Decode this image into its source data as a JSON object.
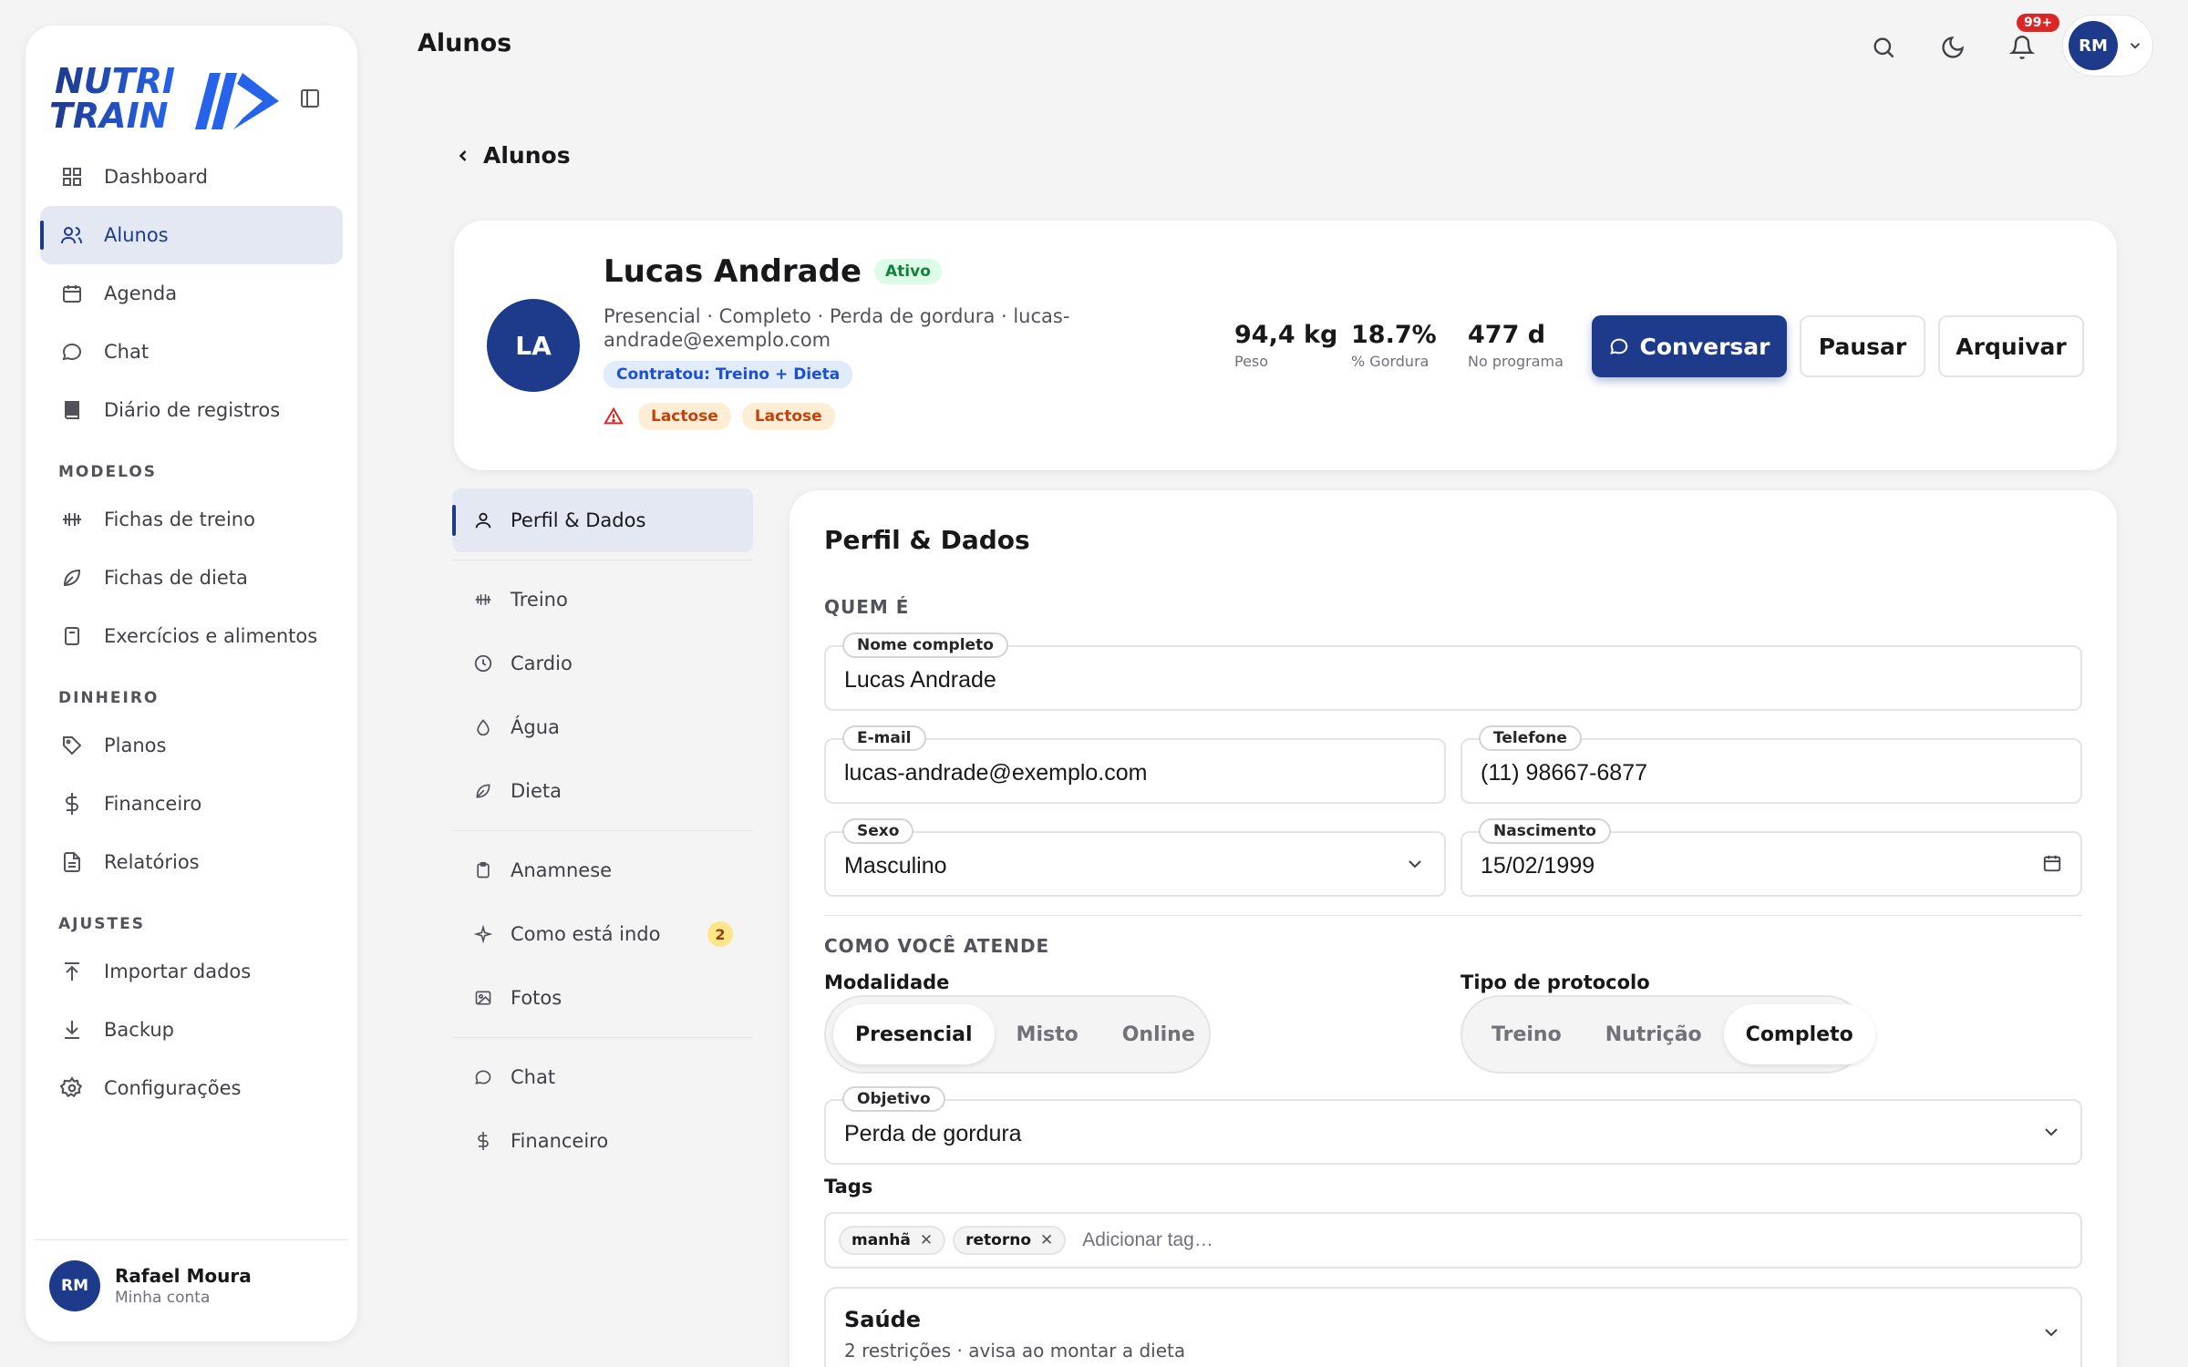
{
  "brand": {
    "line1": "NUTRI",
    "line2": "TRAIN",
    "color": "#1e3a8a"
  },
  "sidebar": {
    "main": [
      {
        "label": "Dashboard",
        "icon": "dashboard-icon"
      },
      {
        "label": "Alunos",
        "icon": "users-icon",
        "active": true
      },
      {
        "label": "Agenda",
        "icon": "calendar-icon"
      },
      {
        "label": "Chat",
        "icon": "chat-icon"
      },
      {
        "label": "Diário de registros",
        "icon": "book-icon"
      }
    ],
    "sections": [
      {
        "title": "MODELOS",
        "items": [
          {
            "label": "Fichas de treino",
            "icon": "dumbbell-icon"
          },
          {
            "label": "Fichas de dieta",
            "icon": "leaf-icon"
          },
          {
            "label": "Exercícios e alimentos",
            "icon": "document-icon"
          }
        ]
      },
      {
        "title": "DINHEIRO",
        "items": [
          {
            "label": "Planos",
            "icon": "tag-icon"
          },
          {
            "label": "Financeiro",
            "icon": "dollar-icon"
          },
          {
            "label": "Relatórios",
            "icon": "report-icon"
          }
        ]
      },
      {
        "title": "AJUSTES",
        "items": [
          {
            "label": "Importar dados",
            "icon": "upload-icon"
          },
          {
            "label": "Backup",
            "icon": "download-icon"
          },
          {
            "label": "Configurações",
            "icon": "gear-icon"
          }
        ]
      }
    ],
    "user": {
      "initials": "RM",
      "name": "Rafael Moura",
      "sub": "Minha conta"
    }
  },
  "topbar": {
    "title": "Alunos",
    "notifications": "99+",
    "avatar_initials": "RM"
  },
  "back_label": "Alunos",
  "profile": {
    "initials": "LA",
    "name": "Lucas Andrade",
    "status": "Ativo",
    "subtitle": "Presencial · Completo · Perda de gordura · lucas-andrade@exemplo.com",
    "contract": "Contratou: Treino + Dieta",
    "allergies": [
      "Lactose",
      "Lactose"
    ],
    "stats": [
      {
        "value": "94,4 kg",
        "label": "Peso"
      },
      {
        "value": "18.7%",
        "label": "% Gordura"
      },
      {
        "value": "477 d",
        "label": "No programa"
      }
    ],
    "actions": {
      "chat": "Conversar",
      "pause": "Pausar",
      "archive": "Arquivar"
    }
  },
  "subnav": {
    "groups": [
      [
        {
          "label": "Perfil & Dados",
          "icon": "user-icon",
          "active": true
        }
      ],
      [
        {
          "label": "Treino",
          "icon": "dumbbell-icon"
        },
        {
          "label": "Cardio",
          "icon": "clock-icon"
        },
        {
          "label": "Água",
          "icon": "drop-icon"
        },
        {
          "label": "Dieta",
          "icon": "leaf-icon"
        }
      ],
      [
        {
          "label": "Anamnese",
          "icon": "clipboard-icon"
        },
        {
          "label": "Como está indo",
          "icon": "sparkle-icon",
          "count": "2"
        },
        {
          "label": "Fotos",
          "icon": "image-icon"
        }
      ],
      [
        {
          "label": "Chat",
          "icon": "chat-icon"
        },
        {
          "label": "Financeiro",
          "icon": "dollar-icon"
        }
      ]
    ]
  },
  "form": {
    "title": "Perfil & Dados",
    "section_who": "QUEM É",
    "full_name": {
      "label": "Nome completo",
      "value": "Lucas Andrade"
    },
    "email": {
      "label": "E-mail",
      "value": "lucas-andrade@exemplo.com"
    },
    "phone": {
      "label": "Telefone",
      "value": "(11) 98667-6877"
    },
    "sex": {
      "label": "Sexo",
      "value": "Masculino"
    },
    "birth": {
      "label": "Nascimento",
      "value": "15/02/1999"
    },
    "section_how": "COMO VOCÊ ATENDE",
    "modality": {
      "label": "Modalidade",
      "options": [
        "Presencial",
        "Misto",
        "Online"
      ],
      "selected": "Presencial"
    },
    "protocol": {
      "label": "Tipo de protocolo",
      "options": [
        "Treino",
        "Nutrição",
        "Completo"
      ],
      "selected": "Completo"
    },
    "goal": {
      "label": "Objetivo",
      "value": "Perda de gordura"
    },
    "tags": {
      "label": "Tags",
      "items": [
        "manhã",
        "retorno"
      ],
      "placeholder": "Adicionar tag…"
    },
    "health": {
      "title": "Saúde",
      "sub": "2 restrições · avisa ao montar a dieta"
    }
  }
}
